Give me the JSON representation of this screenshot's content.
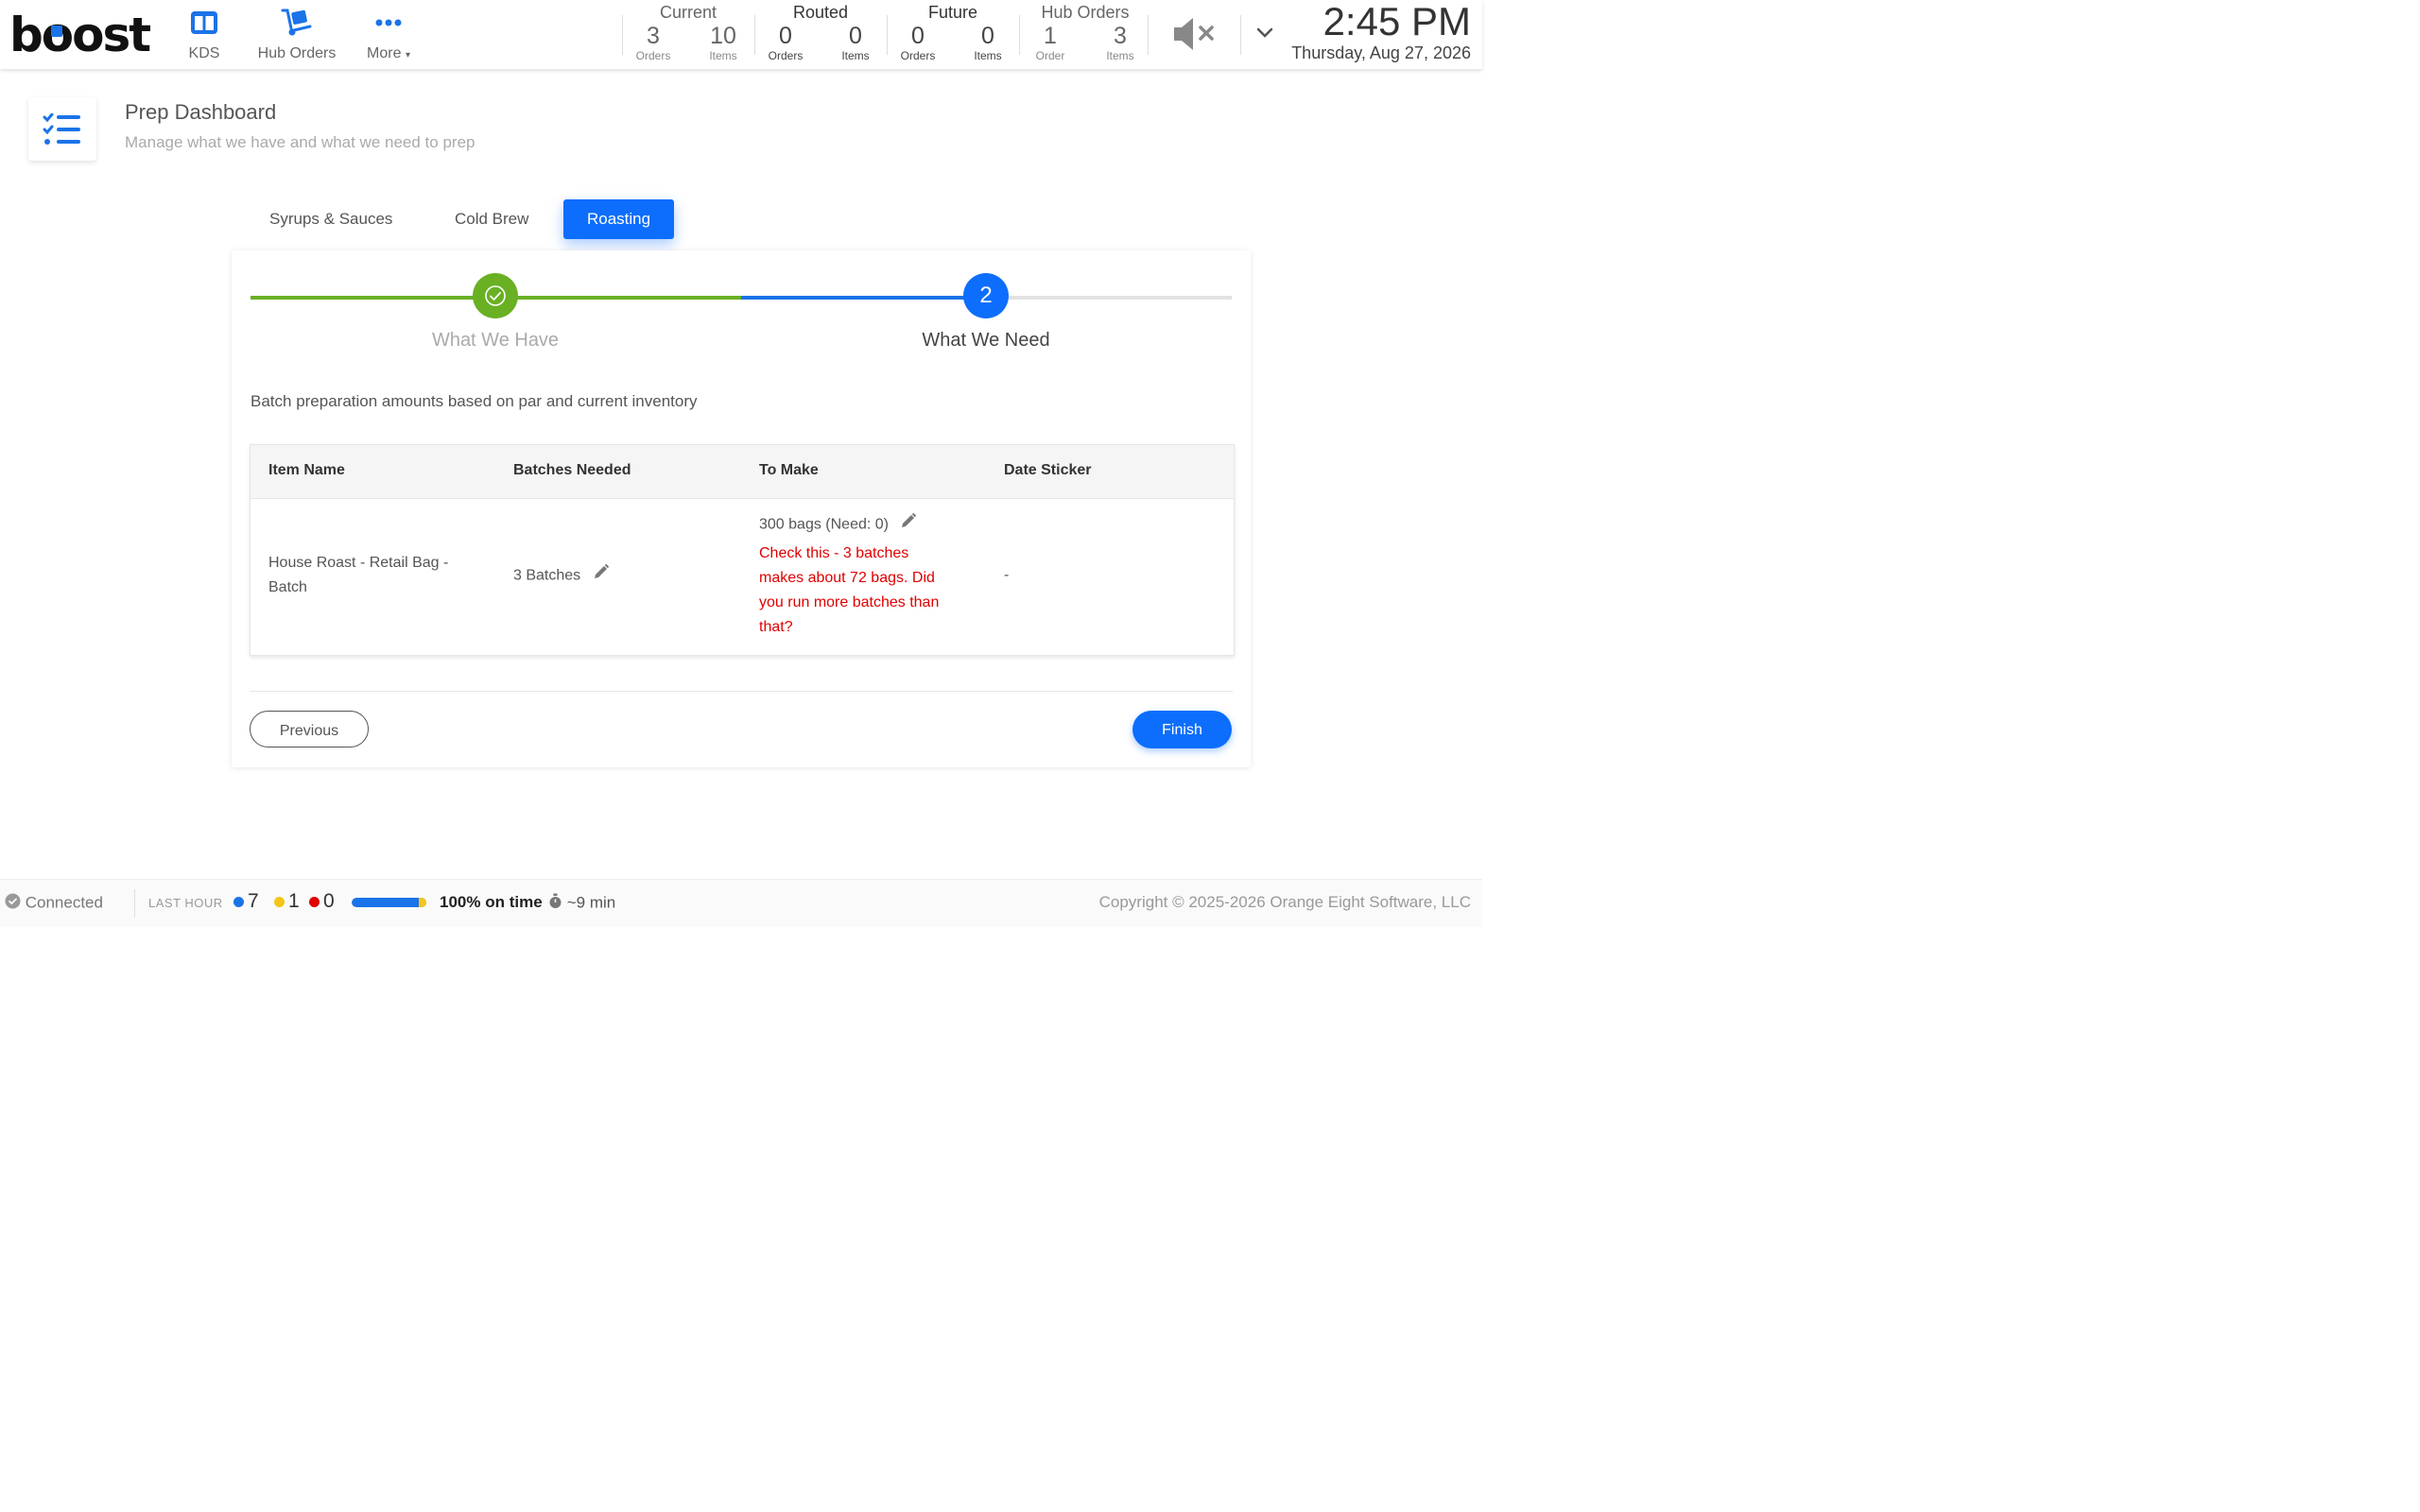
{
  "app": {
    "logo": "boost",
    "brand_color": "#0d6efd"
  },
  "nav": [
    {
      "label": "KDS",
      "icon": "kds-columns-icon"
    },
    {
      "label": "Hub Orders",
      "icon": "hand-truck-icon"
    },
    {
      "label": "More",
      "icon": "more-dots-icon"
    }
  ],
  "stats": {
    "current": {
      "title": "Current",
      "orders": "3",
      "orders_label": "Orders",
      "items": "10",
      "items_label": "Items"
    },
    "routed": {
      "title": "Routed",
      "orders": "0",
      "orders_label": "Orders",
      "items": "0",
      "items_label": "Items"
    },
    "future": {
      "title": "Future",
      "orders": "0",
      "orders_label": "Orders",
      "items": "0",
      "items_label": "Items"
    },
    "hub": {
      "title": "Hub Orders",
      "orders": "1",
      "orders_label": "Order",
      "items": "3",
      "items_label": "Items"
    }
  },
  "clock": {
    "time": "2:45 PM",
    "date": "Thursday, Aug 27, 2026"
  },
  "header": {
    "title": "Prep Dashboard",
    "subtitle": "Manage what we have and what we need to prep"
  },
  "tabs": [
    {
      "label": "Syrups & Sauces",
      "active": false
    },
    {
      "label": "Cold Brew",
      "active": false
    },
    {
      "label": "Roasting",
      "active": true
    }
  ],
  "stepper": {
    "steps": [
      {
        "label": "What We Have",
        "state": "done"
      },
      {
        "label": "What We Need",
        "number": "2",
        "state": "active"
      }
    ],
    "done_color": "#6ab023",
    "active_color": "#0d6efd"
  },
  "description": "Batch preparation amounts based on par and current inventory",
  "table": {
    "columns": [
      "Item Name",
      "Batches Needed",
      "To Make",
      "Date Sticker"
    ],
    "rows": [
      {
        "item_name_line1": "House Roast - Retail Bag -",
        "item_name_line2": "Batch",
        "batches": "3 Batches",
        "to_make": "300 bags (Need: 0)",
        "warning_lines": [
          "Check this - 3 batches",
          "makes about 72 bags. Did",
          "you run more batches than",
          "that?"
        ],
        "date_sticker": "-"
      }
    ]
  },
  "buttons": {
    "previous": "Previous",
    "finish": "Finish"
  },
  "footer": {
    "status": "Connected",
    "last_hour_label": "LAST HOUR",
    "blue_count": "7",
    "yellow_count": "1",
    "red_count": "0",
    "on_time_fraction": 1.0,
    "on_time": "100% on time",
    "avg_time": "~9 min",
    "copyright": "Copyright © 2025-2026 Orange Eight Software, LLC"
  }
}
